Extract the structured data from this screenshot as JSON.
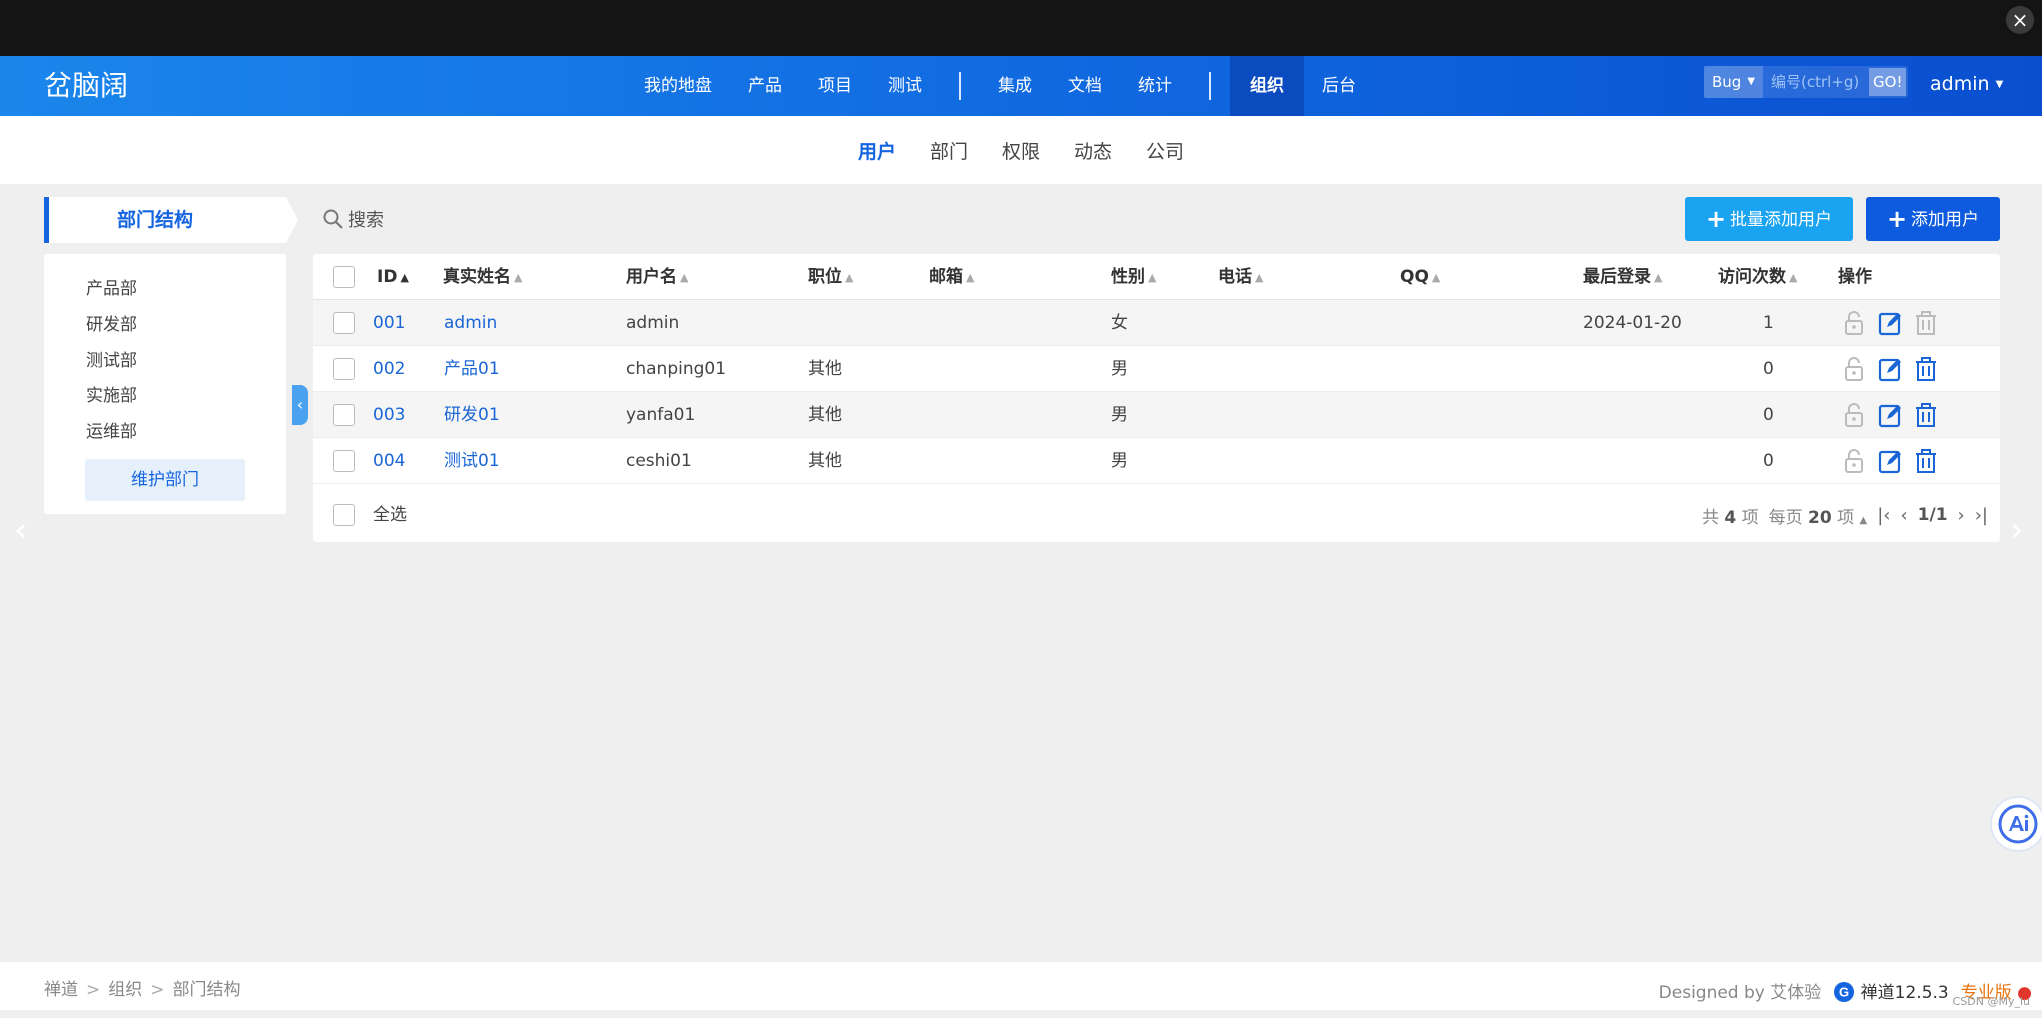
{
  "window": {
    "close_label": "×"
  },
  "header": {
    "brand": "岔脑阔",
    "nav": [
      "我的地盘",
      "产品",
      "项目",
      "测试",
      "集成",
      "文档",
      "统计",
      "组织",
      "后台"
    ],
    "active_nav": "组织",
    "search_type": "Bug",
    "search_placeholder": "编号(ctrl+g)",
    "search_go": "GO!",
    "user": "admin"
  },
  "subnav": [
    "用户",
    "部门",
    "权限",
    "动态",
    "公司"
  ],
  "sidebar": {
    "title": "部门结构",
    "departments": [
      "产品部",
      "研发部",
      "测试部",
      "实施部",
      "运维部"
    ],
    "maintain_label": "维护部门"
  },
  "toolbar": {
    "search_label": "搜索",
    "batch_add_label": "批量添加用户",
    "add_label": "添加用户"
  },
  "table": {
    "columns": [
      "ID",
      "真实姓名",
      "用户名",
      "职位",
      "邮箱",
      "性别",
      "电话",
      "QQ",
      "最后登录",
      "访问次数",
      "操作"
    ],
    "rows": [
      {
        "id": "001",
        "realname": "admin",
        "username": "admin",
        "role": "",
        "email": "",
        "gender": "女",
        "phone": "",
        "qq": "",
        "last": "2024-01-20",
        "visits": "1"
      },
      {
        "id": "002",
        "realname": "产品01",
        "username": "chanping01",
        "role": "其他",
        "email": "",
        "gender": "男",
        "phone": "",
        "qq": "",
        "last": "",
        "visits": "0"
      },
      {
        "id": "003",
        "realname": "研发01",
        "username": "yanfa01",
        "role": "其他",
        "email": "",
        "gender": "男",
        "phone": "",
        "qq": "",
        "last": "",
        "visits": "0"
      },
      {
        "id": "004",
        "realname": "测试01",
        "username": "ceshi01",
        "role": "其他",
        "email": "",
        "gender": "男",
        "phone": "",
        "qq": "",
        "last": "",
        "visits": "0"
      }
    ],
    "select_all": "全选"
  },
  "pager": {
    "total_prefix": "共",
    "total": "4",
    "total_suffix": "项",
    "per_prefix": "每页",
    "per": "20",
    "per_suffix": "项",
    "page": "1/1"
  },
  "footer": {
    "breadcrumb": [
      "禅道",
      "组织",
      "部门结构"
    ],
    "designed_by": "Designed by 艾体验",
    "version": "禅道12.5.3",
    "edition": "专业版",
    "watermark": "CSDN @My_lu"
  },
  "colors": {
    "primary": "#1565e0",
    "header_start": "#1b86ec",
    "header_end": "#0a4fd0",
    "batch_btn": "#1aa3f0"
  }
}
